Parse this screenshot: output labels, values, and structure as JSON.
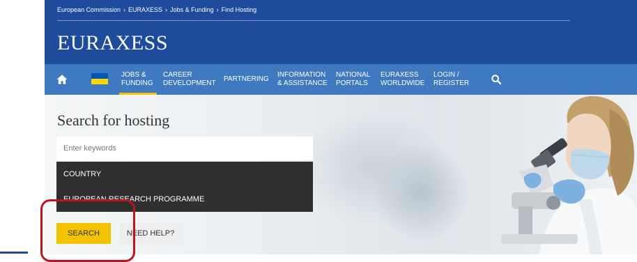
{
  "breadcrumb": [
    "European Commission",
    "EURAXESS",
    "Jobs & Funding",
    "Find Hosting"
  ],
  "breadcrumb_separator": "›",
  "brand": "EURAXESS",
  "nav": {
    "items": [
      {
        "label": "JOBS &\nFUNDING",
        "active": true
      },
      {
        "label": "CAREER\nDEVELOPMENT",
        "active": false
      },
      {
        "label": "PARTNERING",
        "active": false
      },
      {
        "label": "INFORMATION\n& ASSISTANCE",
        "active": false
      },
      {
        "label": "NATIONAL\nPORTALS",
        "active": false
      },
      {
        "label": "EURAXESS\nWORLDWIDE",
        "active": false
      },
      {
        "label": "LOGIN /\nREGISTER",
        "active": false
      }
    ]
  },
  "search": {
    "title": "Search for hosting",
    "keywords_placeholder": "Enter keywords",
    "country_label": "COUNTRY",
    "programme_label": "EUROPEAN RESEARCH PROGRAMME",
    "search_button": "SEARCH",
    "help_button": "NEED HELP?"
  },
  "colors": {
    "header_blue": "#1e4b9b",
    "nav_blue": "#3f79bf",
    "accent_yellow": "#f3c300",
    "dark_select": "#2f2f2f",
    "annotation_red": "#c0121e"
  },
  "icons": [
    "home-icon",
    "ukraine-flag-icon",
    "search-icon"
  ]
}
